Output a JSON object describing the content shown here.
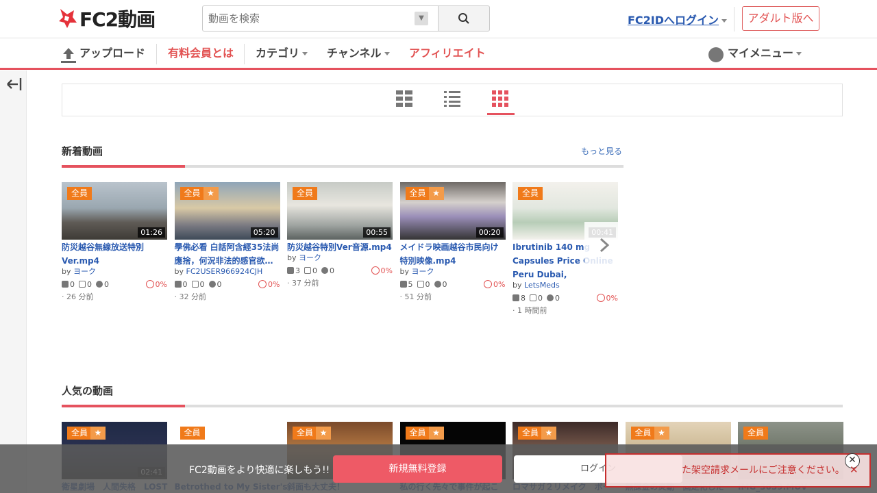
{
  "header": {
    "logo_text": "FC2動画",
    "search_placeholder": "動画を検索",
    "login_label": "FC2IDへログイン",
    "adult_label": "アダルト版へ"
  },
  "nav": {
    "upload": "アップロード",
    "premium": "有料会員とは",
    "category": "カテゴリ",
    "channel": "チャンネル",
    "affiliate": "アフィリエイト",
    "mymenu": "マイメニュー"
  },
  "colors": {
    "accent": "#e5525e",
    "brand_red": "#e25252",
    "link": "#2a5ab0",
    "badge": "#f07a1a"
  },
  "views": {
    "active": "thumbnail-grid"
  },
  "new_videos": {
    "title": "新着動画",
    "more": "もっと見る",
    "items": [
      {
        "badge": "全員",
        "star": false,
        "duration": "01:26",
        "title": "防災越谷無線放送特別Ver.mp4",
        "by": "by",
        "user": "ヨーク",
        "plays": "0",
        "ads": "0",
        "comments": "0",
        "rate": "0%",
        "time": "· 26 分前"
      },
      {
        "badge": "全員",
        "star": true,
        "duration": "05:20",
        "title": "學佛必看 白話阿含經35法尚應捨，何況非法的感官欲…",
        "by": "by",
        "user": "FC2USER966924CJH",
        "plays": "0",
        "ads": "0",
        "comments": "0",
        "rate": "0%",
        "time": "· 32 分前"
      },
      {
        "badge": "全員",
        "star": false,
        "duration": "00:55",
        "title": "防災越谷特別Ver音源.mp4",
        "by": "by",
        "user": "ヨーク",
        "plays": "3",
        "ads": "0",
        "comments": "0",
        "rate": "0%",
        "time": "· 37 分前"
      },
      {
        "badge": "全員",
        "star": true,
        "duration": "00:20",
        "title": "メイドラ映画越谷市民向け特別映像.mp4",
        "by": "by",
        "user": "ヨーク",
        "plays": "5",
        "ads": "0",
        "comments": "0",
        "rate": "0%",
        "time": "· 51 分前"
      },
      {
        "badge": "全員",
        "star": false,
        "duration": "00:41",
        "title": "Ibrutinib 140 mg Capsules Price Online Peru Dubai,",
        "by": "by",
        "user": "LetsMeds",
        "plays": "8",
        "ads": "0",
        "comments": "0",
        "rate": "0%",
        "time": "· 1 時間前"
      }
    ]
  },
  "popular": {
    "title": "人気の動画",
    "items": [
      {
        "badge": "全員",
        "star": true,
        "duration": "02:41",
        "title": "衛星劇場　人間失格　LOST"
      },
      {
        "badge": "全員",
        "star": false,
        "duration": "",
        "title": "Betrothed to My Sister's"
      },
      {
        "badge": "全員",
        "star": true,
        "duration": "",
        "title": "斜面も大丈夫！"
      },
      {
        "badge": "全員",
        "star": true,
        "duration": "",
        "title": "私の行く先々で事件が起こ"
      },
      {
        "badge": "全員",
        "star": true,
        "duration": "",
        "title": "ロマサガ２リメイク　ボー"
      },
      {
        "badge": "全員",
        "star": true,
        "duration": "",
        "title": "無課金の炎動　固定化した"
      },
      {
        "badge": "全員",
        "star": false,
        "duration": "",
        "title": "IMG_3039.MOV"
      }
    ]
  },
  "bottom": {
    "text": "FC2動画をより快適に楽しもう!!",
    "register": "新規無料登録",
    "login": "ログイン",
    "notice": "た架空請求メールにご注意ください。"
  }
}
